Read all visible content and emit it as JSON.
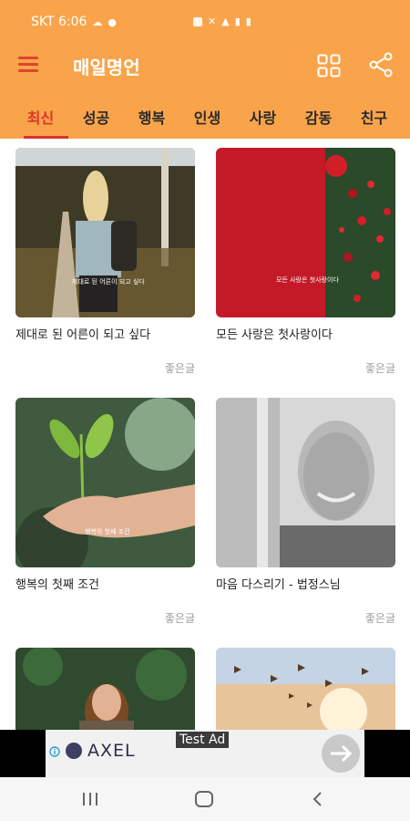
{
  "status": {
    "carrier_time": "SKT 6:06",
    "battery": "battery-icon"
  },
  "appbar": {
    "title": "매일명언",
    "menu_icon": "hamburger-menu-icon",
    "grid_icon": "grid-view-icon",
    "share_icon": "share-icon"
  },
  "tabs": [
    {
      "label": "최신",
      "active": true
    },
    {
      "label": "성공",
      "active": false
    },
    {
      "label": "행복",
      "active": false
    },
    {
      "label": "인생",
      "active": false
    },
    {
      "label": "사랑",
      "active": false
    },
    {
      "label": "감동",
      "active": false
    },
    {
      "label": "친구",
      "active": false
    }
  ],
  "cards": [
    {
      "title": "제대로 된 어른이 되고 싶다",
      "category": "좋은글",
      "overlay": "제대로 된 어른이 되고 싶다"
    },
    {
      "title": "모든 사랑은 첫사랑이다",
      "category": "좋은글",
      "overlay": "모든 사랑은 첫사랑이다"
    },
    {
      "title": "행복의 첫째 조건",
      "category": "좋은글",
      "overlay": "행복의 첫째 조건"
    },
    {
      "title": "마음 다스리기 - 법정스님",
      "category": "좋은글",
      "overlay": ""
    },
    {
      "title": "",
      "category": "",
      "overlay": ""
    },
    {
      "title": "",
      "category": "",
      "overlay": ""
    }
  ],
  "ad": {
    "label": "Test Ad",
    "brand": "AXEL"
  },
  "colors": {
    "accent": "#f9a44b",
    "active_tab": "#d9342b"
  }
}
